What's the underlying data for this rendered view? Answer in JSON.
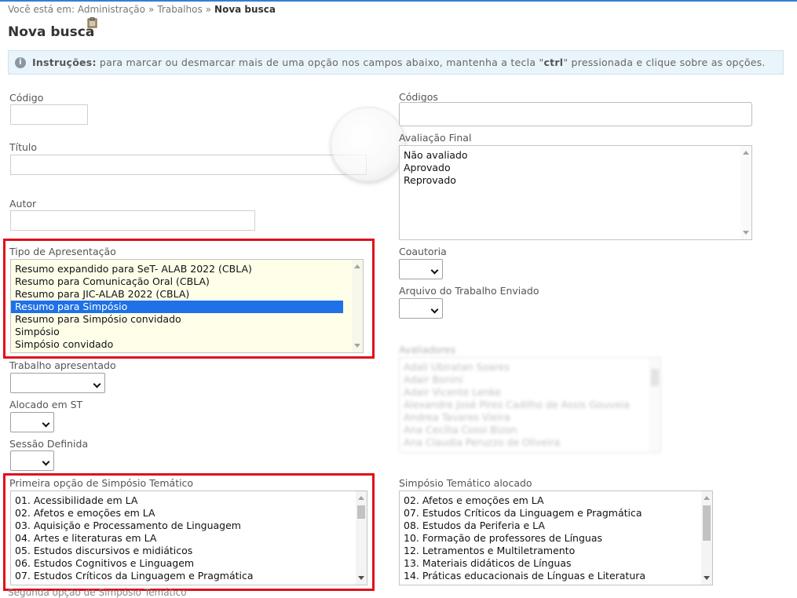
{
  "breadcrumb": {
    "prefix": "Você está em:",
    "items": [
      "Administração",
      "Trabalhos"
    ],
    "current": "Nova busca",
    "separator": "»"
  },
  "page": {
    "title": "Nova busca",
    "title_icon": "clipboard-icon"
  },
  "instructions": {
    "icon": "info-icon",
    "label": "Instruções:",
    "text_before": " para marcar ou desmarcar mais de uma opção nos campos abaixo, mantenha a tecla \"",
    "key": "ctrl",
    "text_after": "\" pressionada e clique sobre as opções."
  },
  "fields": {
    "codigo": {
      "label": "Código",
      "value": ""
    },
    "titulo": {
      "label": "Título",
      "value": ""
    },
    "autor": {
      "label": "Autor",
      "value": ""
    },
    "codigos": {
      "label": "Códigos",
      "value": ""
    },
    "avaliacao_final": {
      "label": "Avaliação Final",
      "options": [
        "Não avaliado",
        "Aprovado",
        "Reprovado"
      ]
    },
    "tipo_apresentacao": {
      "label": "Tipo de Apresentação",
      "options": [
        "Resumo expandido para SeT- ALAB 2022 (CBLA)",
        "Resumo para Comunicação Oral (CBLA)",
        "Resumo para JIC-ALAB 2022 (CBLA)",
        "Resumo para Simpósio",
        "Resumo para Simpósio convidado",
        "Simpósio",
        "Simpósio convidado"
      ],
      "selected": "Resumo para Simpósio"
    },
    "coautoria": {
      "label": "Coautoria",
      "value": ""
    },
    "arquivo_trabalho": {
      "label": "Arquivo do Trabalho Enviado",
      "value": ""
    },
    "trabalho_apresentado": {
      "label": "Trabalho apresentado",
      "value": ""
    },
    "alocado_st": {
      "label": "Alocado em ST",
      "value": ""
    },
    "sessao_definida": {
      "label": "Sessão Definida",
      "value": ""
    },
    "primeira_opcao": {
      "label": "Primeira opção de Simpósio Temático",
      "options": [
        "01. Acessibilidade em LA",
        "02. Afetos e emoções em LA",
        "03. Aquisição e Processamento de Linguagem",
        "04. Artes e literaturas em LA",
        "05. Estudos discursivos e midiáticos",
        "06. Estudos Cognitivos e Linguagem",
        "07. Estudos Críticos da Linguagem e Pragmática"
      ]
    },
    "st_alocado": {
      "label": "Simpósio Temático alocado",
      "options": [
        "02. Afetos e emoções em LA",
        "07. Estudos Críticos da Linguagem e Pragmática",
        "08. Estudos da Periferia e LA",
        "10. Formação de professores de Línguas",
        "12. Letramentos e Multiletramento",
        "13. Materiais didáticos de Línguas",
        "14. Práticas educacionais de Línguas e Literatura"
      ]
    }
  },
  "blurred_list": {
    "label": "Avaliadores",
    "options": [
      "Adali Ubiratan Soares",
      "Adair Bonini",
      "Adair Vicente Lenke",
      "Alexandre José Pires Cadilho de Assis Gouveia",
      "Andrea Tavares Vieira",
      "Ana Cecília Cossi Bizon",
      "Ana Claudia Peruzzo de Oliveira"
    ]
  },
  "footer_cut": {
    "text": "Segunda opção de Simpósio Temático"
  }
}
